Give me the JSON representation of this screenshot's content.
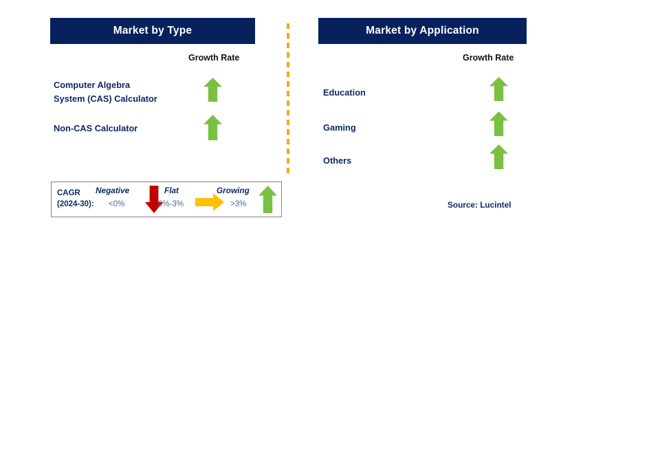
{
  "panels": [
    {
      "id": "market-by-type",
      "title": "Market by Type",
      "growth_rate_label": "Growth Rate",
      "rows": [
        {
          "label": "Computer Algebra\nSystem (CAS) Calculator",
          "trend": "growing",
          "icon": "arrow-up-icon"
        },
        {
          "label": "Non-CAS Calculator",
          "trend": "growing",
          "icon": "arrow-up-icon"
        }
      ]
    },
    {
      "id": "market-by-application",
      "title": "Market by Application",
      "growth_rate_label": "Growth Rate",
      "rows": [
        {
          "label": "Education",
          "trend": "growing",
          "icon": "arrow-up-icon"
        },
        {
          "label": "Gaming",
          "trend": "growing",
          "icon": "arrow-up-icon"
        },
        {
          "label": "Others",
          "trend": "growing",
          "icon": "arrow-up-icon"
        }
      ]
    }
  ],
  "legend": {
    "cagr_label": "CAGR\n(2024-30):",
    "items": [
      {
        "term": "Negative",
        "range": "<0%",
        "icon": "arrow-down-icon",
        "color": "#c00000"
      },
      {
        "term": "Flat",
        "range": "0%-3%",
        "icon": "arrow-right-icon",
        "color": "#ffc000"
      },
      {
        "term": "Growing",
        "range": ">3%",
        "icon": "arrow-up-icon",
        "color": "#7ac143"
      }
    ]
  },
  "source": "Source: Lucintel",
  "colors": {
    "header_bg": "#06215c",
    "header_text": "#ffffff",
    "label_text": "#0d2a66",
    "range_text": "#4a6a93",
    "arrow_up": "#7ac143",
    "arrow_down": "#c00000",
    "arrow_right": "#ffc000",
    "divider": "#f5a800",
    "legend_border": "#808080"
  }
}
